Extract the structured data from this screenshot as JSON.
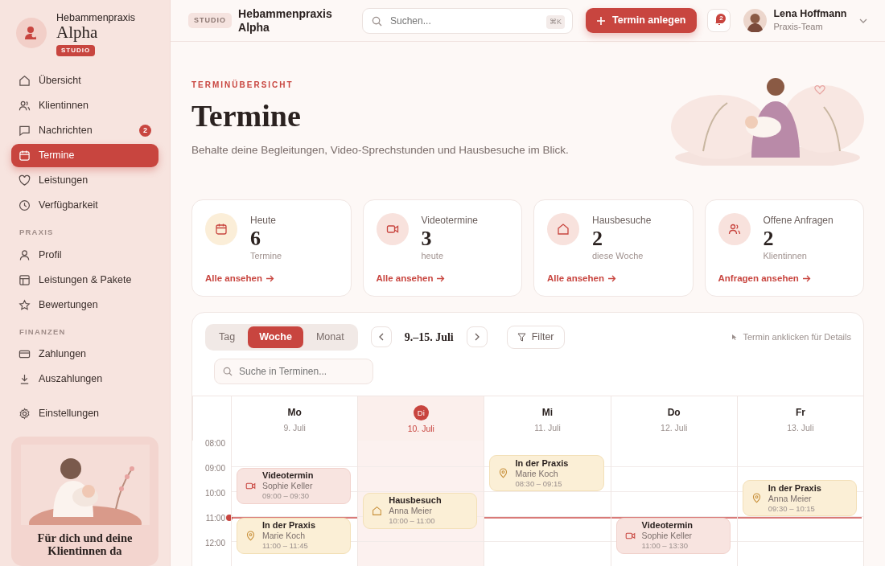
{
  "brand": {
    "name_top": "Hebammenpraxis",
    "name_main": "Alpha",
    "badge": "STUDIO"
  },
  "sidebar": {
    "groups": [
      {
        "items": [
          {
            "label": "Übersicht",
            "selected": false
          },
          {
            "label": "Klientinnen",
            "selected": false
          },
          {
            "label": "Nachrichten",
            "selected": false,
            "badge": "2"
          },
          {
            "label": "Termine",
            "selected": true
          },
          {
            "label": "Leistungen",
            "selected": false
          },
          {
            "label": "Verfügbarkeit",
            "selected": false
          }
        ]
      },
      {
        "title": "PRAXIS",
        "items": [
          {
            "label": "Profil",
            "selected": false
          },
          {
            "label": "Leistungen & Pakete",
            "selected": false
          },
          {
            "label": "Bewertungen",
            "selected": false
          }
        ]
      },
      {
        "title": "FINANZEN",
        "items": [
          {
            "label": "Zahlungen",
            "selected": false
          },
          {
            "label": "Auszahlungen",
            "selected": false
          }
        ]
      },
      {
        "items": [
          {
            "label": "Einstellungen",
            "selected": false
          }
        ]
      }
    ],
    "promo": {
      "text": "Für dich und deine Klientinnen da"
    }
  },
  "topbar": {
    "tag": "STUDIO",
    "title": "Hebammenpraxis Alpha",
    "search": {
      "placeholder": "Suchen...",
      "shortcut": "⌘K"
    },
    "primary_button": "Termin anlegen",
    "notifications": "2",
    "user": {
      "name": "Lena Hoffmann",
      "role": "Praxis-Team"
    }
  },
  "header": {
    "eyebrow": "TERMINÜBERSICHT",
    "title": "Termine",
    "subtitle": "Behalte deine Begleitungen, Video-Sprechstunden und Hausbesuche im Blick."
  },
  "stats": [
    {
      "label": "Heute",
      "value": "6",
      "caption": "Termine",
      "link": "Alle ansehen"
    },
    {
      "label": "Videotermine",
      "value": "3",
      "caption": "heute",
      "link": "Alle ansehen"
    },
    {
      "label": "Hausbesuche",
      "value": "2",
      "caption": "diese Woche",
      "link": "Alle ansehen"
    },
    {
      "label": "Offene Anfragen",
      "value": "2",
      "caption": "Klientinnen",
      "link": "Anfragen ansehen"
    }
  ],
  "calendar": {
    "views": [
      {
        "label": "Tag",
        "selected": false
      },
      {
        "label": "Woche",
        "selected": true
      },
      {
        "label": "Monat",
        "selected": false
      }
    ],
    "range": "9.–15. Juli",
    "filter": "Filter",
    "hint": "Termin anklicken für Details",
    "search": {
      "placeholder": "Suche in Terminen..."
    },
    "hours": [
      "08:00",
      "09:00",
      "10:00",
      "11:00",
      "12:00"
    ],
    "days": [
      {
        "name": "Mo",
        "date": "9. Juli",
        "selected": false,
        "events": [
          {
            "kind": "video",
            "title": "Videotermin",
            "client": "Sophie Keller",
            "time": "09:00 – 09:30"
          },
          {
            "kind": "praxis",
            "title": "In der Praxis",
            "client": "Marie Koch",
            "time": "11:00 – 11:45"
          }
        ]
      },
      {
        "name": "Di",
        "date": "10. Juli",
        "selected": true,
        "events": [
          {
            "kind": "hausbesuch",
            "title": "Hausbesuch",
            "client": "Anna Meier",
            "time": "10:00 – 11:00"
          }
        ]
      },
      {
        "name": "Mi",
        "date": "11. Juli",
        "selected": false,
        "events": [
          {
            "kind": "praxis",
            "title": "In der Praxis",
            "client": "Marie Koch",
            "time": "08:30 – 09:15"
          }
        ]
      },
      {
        "name": "Do",
        "date": "12. Juli",
        "selected": false,
        "events": [
          {
            "kind": "video",
            "title": "Videotermin",
            "client": "Sophie Keller",
            "time": "11:00 – 13:30"
          }
        ]
      },
      {
        "name": "Fr",
        "date": "13. Juli",
        "selected": false,
        "events": [
          {
            "kind": "praxis",
            "title": "In der Praxis",
            "client": "Anna Meier",
            "time": "09:30 – 10:15"
          }
        ]
      }
    ]
  }
}
